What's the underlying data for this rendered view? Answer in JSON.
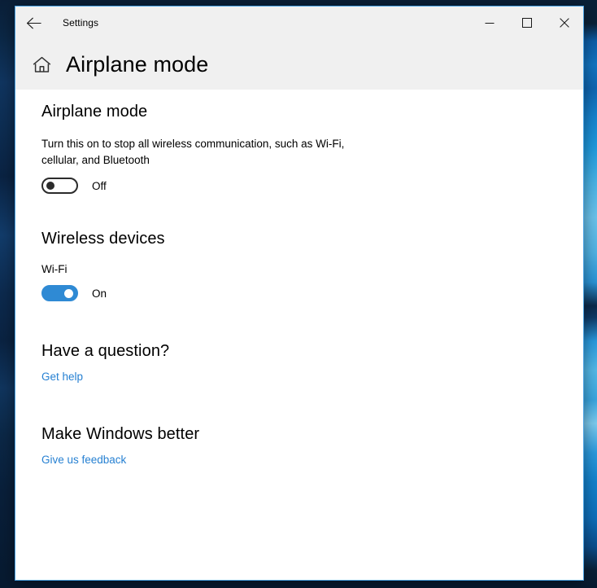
{
  "window": {
    "titlebar_title": "Settings",
    "back_icon": "back-arrow-icon",
    "minimize_label": "─",
    "maximize_label": "□",
    "close_label": "✕"
  },
  "header": {
    "home_icon": "home-icon",
    "page_title": "Airplane mode"
  },
  "airplane_section": {
    "heading": "Airplane mode",
    "description": "Turn this on to stop all wireless communication, such as Wi-Fi, cellular, and Bluetooth",
    "toggle_state": "Off"
  },
  "wireless_section": {
    "heading": "Wireless devices",
    "wifi_label": "Wi-Fi",
    "wifi_toggle_state": "On"
  },
  "question_section": {
    "heading": "Have a question?",
    "link_label": "Get help"
  },
  "feedback_section": {
    "heading": "Make Windows better",
    "link_label": "Give us feedback"
  },
  "colors": {
    "accent_blue": "#2f8ad4",
    "link_blue": "#2680d2",
    "chrome_gray": "#f0f0f0",
    "window_border": "#4ba3e3",
    "content_white": "#ffffff",
    "text_black": "#000000"
  }
}
